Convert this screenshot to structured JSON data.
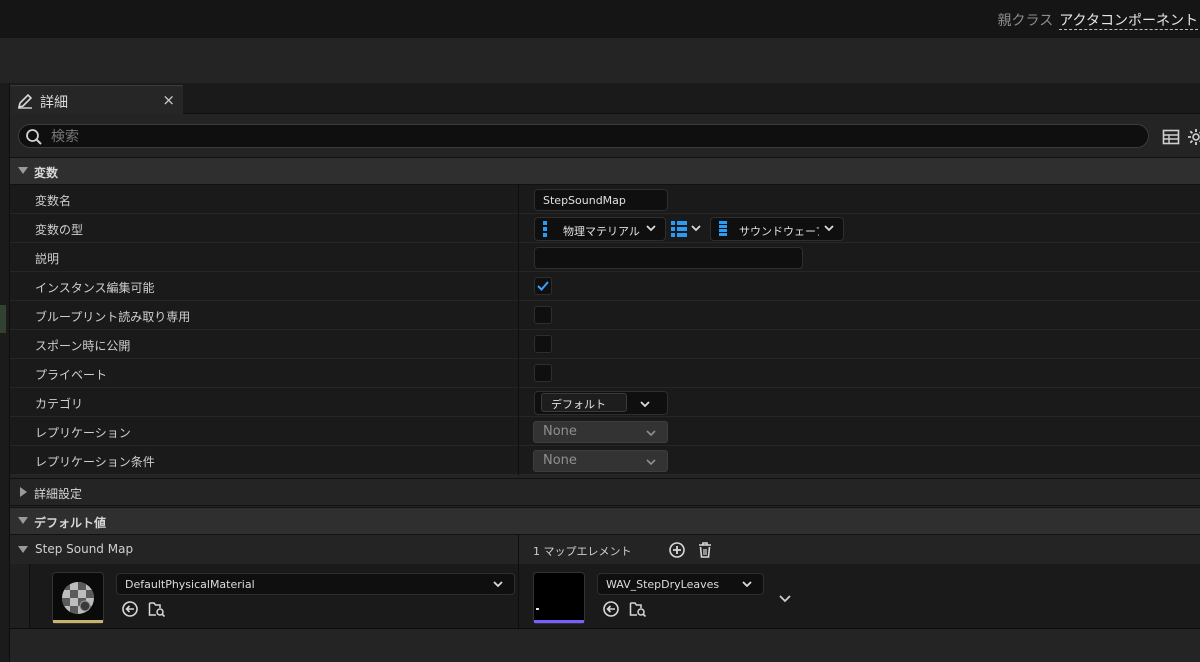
{
  "header": {
    "parent_class_label": "親クラス",
    "parent_class_value": "アクタコンポーネント"
  },
  "tab": {
    "title": "詳細",
    "close": "×"
  },
  "search": {
    "placeholder": "検索"
  },
  "sections": {
    "variable": "変数",
    "advanced": "詳細設定",
    "default_value": "デフォルト値"
  },
  "rows": {
    "variable_name": {
      "label": "変数名",
      "value": "StepSoundMap"
    },
    "variable_type": {
      "label": "変数の型",
      "key_type": "物理マテリアル",
      "value_type": "サウンドウェーブ"
    },
    "description": {
      "label": "説明",
      "value": ""
    },
    "instance_editable": {
      "label": "インスタンス編集可能",
      "checked": true
    },
    "blueprint_read_only": {
      "label": "ブループリント読み取り専用",
      "checked": false
    },
    "expose_on_spawn": {
      "label": "スポーン時に公開",
      "checked": false
    },
    "private": {
      "label": "プライベート",
      "checked": false
    },
    "category": {
      "label": "カテゴリ",
      "value": "デフォルト"
    },
    "replication": {
      "label": "レプリケーション",
      "value": "None"
    },
    "replication_condition": {
      "label": "レプリケーション条件",
      "value": "None"
    }
  },
  "default_value": {
    "map_label": "Step Sound Map",
    "element_count": "1 マップエレメント",
    "key_asset": "DefaultPhysicalMaterial",
    "value_asset": "WAV_StepDryLeaves"
  },
  "colors": {
    "accent_blue": "#2a9cf5",
    "check_blue": "#3aa0ff",
    "material_bar": "#c9b36a",
    "sound_bar": "#7a5cff"
  },
  "icons": {
    "tab": "pencil-icon",
    "search": "search-icon",
    "table_view": "table-view-icon",
    "settings": "gear-icon",
    "add": "plus-circle-icon",
    "delete": "trash-icon",
    "reset": "arrow-left-circle-icon",
    "browse": "folder-search-icon"
  }
}
